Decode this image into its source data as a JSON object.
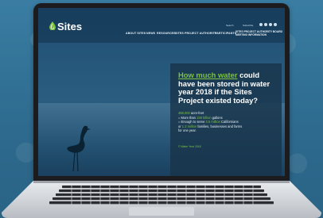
{
  "site": {
    "logo_text": "Sites",
    "brand_color": "#7cc142"
  },
  "header": {
    "utility_links": [
      "Search",
      "Subscribe"
    ],
    "social_icons": [
      "facebook-icon",
      "twitter-icon",
      "instagram-icon",
      "youtube-icon"
    ],
    "menu": [
      "ABOUT SITES",
      "NEWS",
      "RESOURCES",
      "SITES PROJECT AUTHORITY",
      "PARTICIPANTS"
    ],
    "menu_last": "SITES PROJECT AUTHORITY BOARD MEETING INFORMATION"
  },
  "hero": {
    "headline_highlight": "How much water",
    "headline_rest": " could have been stored in water year 2018 if the Sites Project existed today?",
    "stat_line_1_value": "488,000",
    "stat_line_1_text": " acre-feet",
    "stat_line_2_prefix": "= More than ",
    "stat_line_2_value": "159 billion",
    "stat_line_2_text": " gallons",
    "stat_line_3_prefix": "= Enough to serve ",
    "stat_line_3_value": "3.6 million",
    "stat_line_3_text": " Californians",
    "stat_line_4_prefix": "or ",
    "stat_line_4_value": "1.2 million",
    "stat_line_4_text": " families, businesses and farms",
    "stat_line_5": "for one year.",
    "footnote": "© Water Year 2018"
  }
}
